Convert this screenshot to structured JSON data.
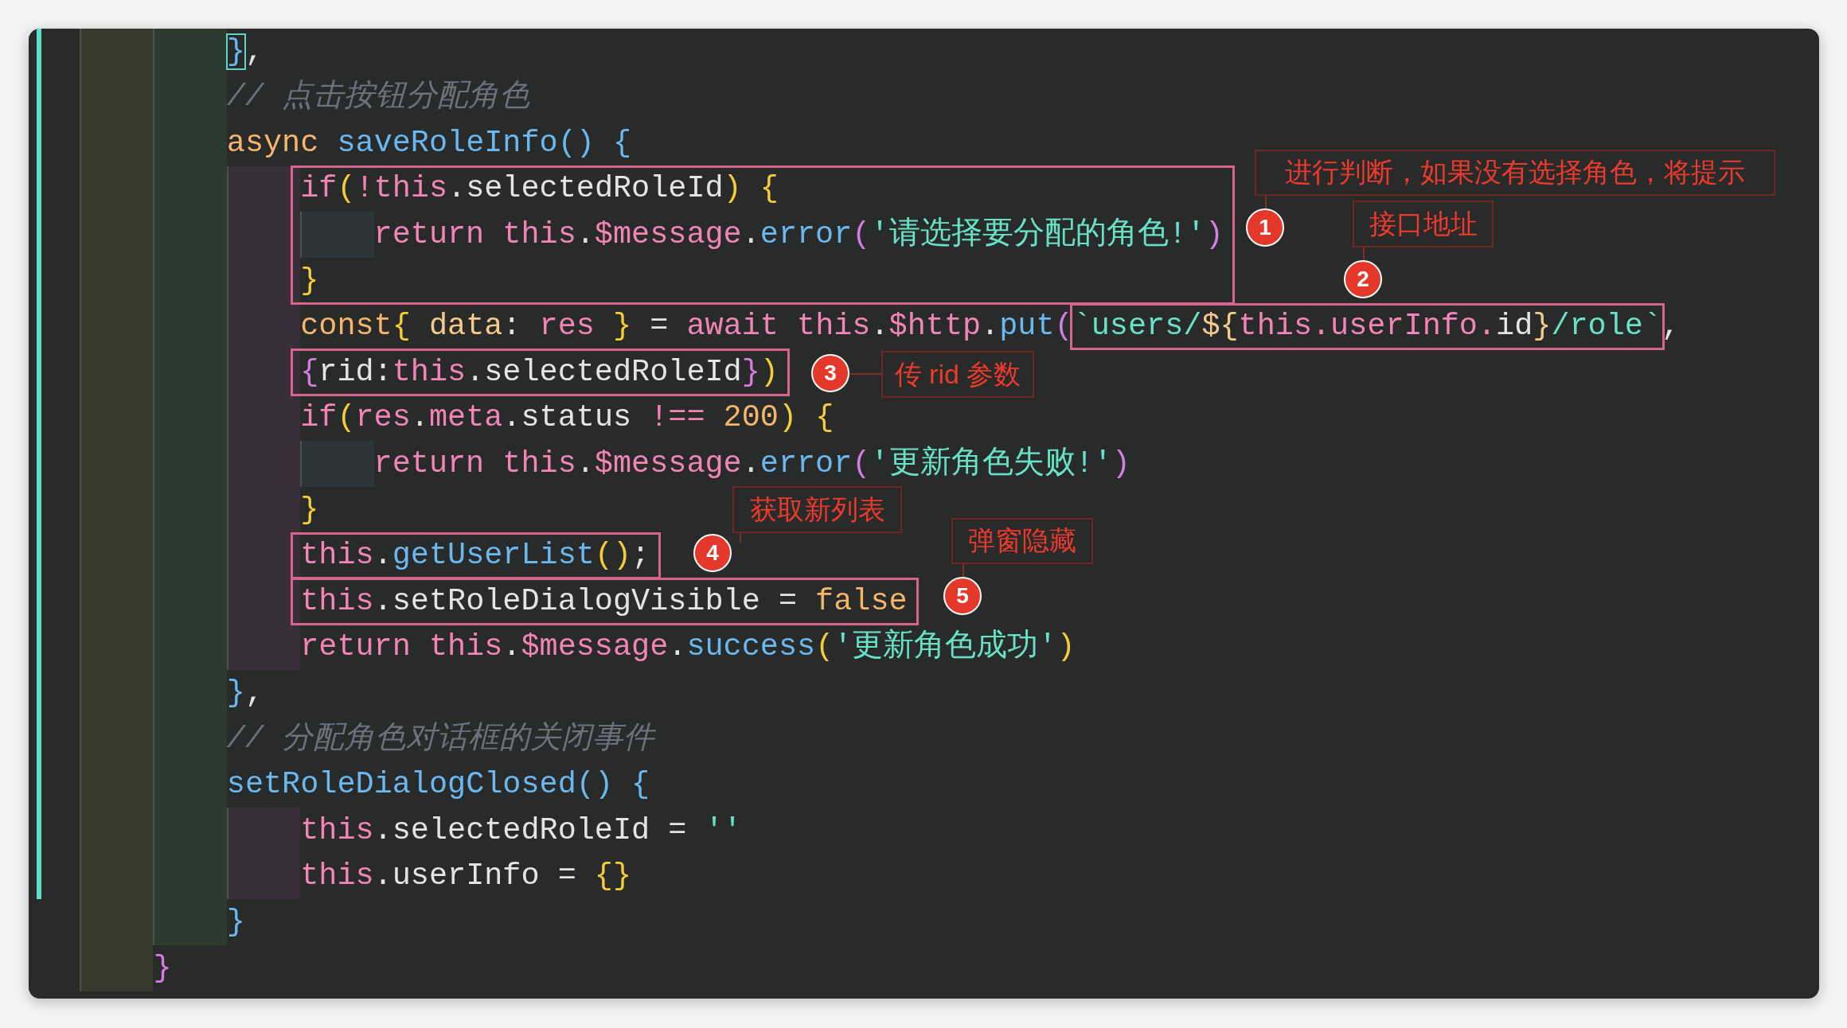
{
  "editor": {
    "blocks": [
      {
        "kind": "block",
        "children": [
          {
            "kind": "line",
            "modified": true,
            "tokens": [
              {
                "t": "}",
                "color": "#6ab8ef",
                "bracket_match": true
              },
              {
                "t": ",",
                "color": "#e4e4e4"
              }
            ]
          },
          {
            "kind": "comment",
            "modified": true,
            "tokens": [
              {
                "t": "// 点击按钮分配角色",
                "color": "#6d717c"
              }
            ]
          },
          {
            "kind": "block",
            "open": {
              "modified": true,
              "tokens": [
                {
                  "t": "async ",
                  "color": "#f6b56c"
                },
                {
                  "t": "saveRoleInfo",
                  "color": "#6ab8ef"
                },
                {
                  "t": "() {",
                  "color": "#6ab8ef"
                }
              ]
            },
            "children": [
              {
                "kind": "block",
                "boxed": true,
                "open": {
                  "modified": true,
                  "tokens": [
                    {
                      "t": "if",
                      "color": "#f185b5"
                    },
                    {
                      "t": "(",
                      "color": "#f5cd39"
                    },
                    {
                      "t": "!this",
                      "color": "#f185b5"
                    },
                    {
                      "t": ".selectedRoleId",
                      "color": "#e4e4e4"
                    },
                    {
                      "t": ") {",
                      "color": "#f5cd39"
                    }
                  ]
                },
                "children": [
                  {
                    "kind": "line",
                    "modified": true,
                    "tokens": [
                      {
                        "t": "return this",
                        "color": "#f185b5"
                      },
                      {
                        "t": ".",
                        "color": "#e4e4e4"
                      },
                      {
                        "t": "$message",
                        "color": "#f185b5"
                      },
                      {
                        "t": ".",
                        "color": "#e4e4e4"
                      },
                      {
                        "t": "error",
                        "color": "#6ab8ef"
                      },
                      {
                        "t": "(",
                        "color": "#d47fe0"
                      },
                      {
                        "t": "'请选择要分配的角色!'",
                        "color": "#68e2c6"
                      },
                      {
                        "t": ")",
                        "color": "#d47fe0"
                      }
                    ]
                  }
                ],
                "close": {
                  "modified": true,
                  "tokens": [
                    {
                      "t": "}",
                      "color": "#f5cd39"
                    }
                  ]
                }
              },
              {
                "kind": "line",
                "modified": true,
                "tokens": [
                  {
                    "t": "const",
                    "color": "#f6b56c"
                  },
                  {
                    "t": "{",
                    "color": "#f5cd39"
                  },
                  {
                    "t": " data",
                    "color": "#f6c98c"
                  },
                  {
                    "t": ": ",
                    "color": "#e4e4e4"
                  },
                  {
                    "t": "res",
                    "color": "#f185b5"
                  },
                  {
                    "t": " }",
                    "color": "#f5cd39"
                  },
                  {
                    "t": " = ",
                    "color": "#e4e4e4"
                  },
                  {
                    "t": "await this",
                    "color": "#f185b5"
                  },
                  {
                    "t": ".",
                    "color": "#e4e4e4"
                  },
                  {
                    "t": "$http",
                    "color": "#f185b5"
                  },
                  {
                    "t": ".",
                    "color": "#e4e4e4"
                  },
                  {
                    "t": "put",
                    "color": "#6ab8ef"
                  },
                  {
                    "t": "(",
                    "color": "#d47fe0"
                  },
                  {
                    "kind": "group",
                    "boxed": true,
                    "tokens": [
                      {
                        "t": "`users/",
                        "color": "#68e2c6"
                      },
                      {
                        "t": "${",
                        "color": "#f6c98c"
                      },
                      {
                        "t": "this.userInfo.",
                        "color": "#f185b5"
                      },
                      {
                        "t": "id",
                        "color": "#e4e4e4"
                      },
                      {
                        "t": "}",
                        "color": "#f6c98c"
                      },
                      {
                        "t": "/role`",
                        "color": "#68e2c6"
                      }
                    ]
                  },
                  {
                    "t": ",",
                    "color": "#e4e4e4"
                  }
                ]
              },
              {
                "kind": "line",
                "modified": true,
                "boxed": true,
                "tokens": [
                  {
                    "t": "{",
                    "color": "#d47fe0"
                  },
                  {
                    "t": "rid:",
                    "color": "#e4e4e4"
                  },
                  {
                    "t": "this",
                    "color": "#f185b5"
                  },
                  {
                    "t": ".selectedRoleId",
                    "color": "#e4e4e4"
                  },
                  {
                    "t": "}",
                    "color": "#d47fe0"
                  },
                  {
                    "t": ")",
                    "color": "#f5cd39"
                  }
                ]
              },
              {
                "kind": "block",
                "open": {
                  "modified": true,
                  "tokens": [
                    {
                      "t": "if",
                      "color": "#f185b5"
                    },
                    {
                      "t": "(",
                      "color": "#f5cd39"
                    },
                    {
                      "t": "res",
                      "color": "#f185b5"
                    },
                    {
                      "t": ".",
                      "color": "#e4e4e4"
                    },
                    {
                      "t": "meta",
                      "color": "#f185b5"
                    },
                    {
                      "t": ".status ",
                      "color": "#e4e4e4"
                    },
                    {
                      "t": "!==",
                      "color": "#f185b5"
                    },
                    {
                      "t": " 200",
                      "color": "#f6b56c"
                    },
                    {
                      "t": ") {",
                      "color": "#f5cd39"
                    }
                  ]
                },
                "children": [
                  {
                    "kind": "line",
                    "modified": true,
                    "tokens": [
                      {
                        "t": "return this",
                        "color": "#f185b5"
                      },
                      {
                        "t": ".",
                        "color": "#e4e4e4"
                      },
                      {
                        "t": "$message",
                        "color": "#f185b5"
                      },
                      {
                        "t": ".",
                        "color": "#e4e4e4"
                      },
                      {
                        "t": "error",
                        "color": "#6ab8ef"
                      },
                      {
                        "t": "(",
                        "color": "#d47fe0"
                      },
                      {
                        "t": "'更新角色失败!'",
                        "color": "#68e2c6"
                      },
                      {
                        "t": ")",
                        "color": "#d47fe0"
                      }
                    ]
                  }
                ],
                "close": {
                  "modified": true,
                  "tokens": [
                    {
                      "t": "}",
                      "color": "#f5cd39"
                    }
                  ]
                }
              },
              {
                "kind": "line",
                "modified": true,
                "boxed": true,
                "tokens": [
                  {
                    "t": "this",
                    "color": "#f185b5"
                  },
                  {
                    "t": ".",
                    "color": "#e4e4e4"
                  },
                  {
                    "t": "getUserList",
                    "color": "#6ab8ef"
                  },
                  {
                    "t": "()",
                    "color": "#f5cd39"
                  },
                  {
                    "t": ";",
                    "color": "#e4e4e4"
                  }
                ]
              },
              {
                "kind": "line",
                "modified": true,
                "boxed": true,
                "tokens": [
                  {
                    "t": "this",
                    "color": "#f185b5"
                  },
                  {
                    "t": ".setRoleDialogVisible = ",
                    "color": "#e4e4e4"
                  },
                  {
                    "t": "false",
                    "color": "#f6b56c"
                  }
                ]
              },
              {
                "kind": "line",
                "modified": true,
                "tokens": [
                  {
                    "t": "return this",
                    "color": "#f185b5"
                  },
                  {
                    "t": ".",
                    "color": "#e4e4e4"
                  },
                  {
                    "t": "$message",
                    "color": "#f185b5"
                  },
                  {
                    "t": ".",
                    "color": "#e4e4e4"
                  },
                  {
                    "t": "success",
                    "color": "#6ab8ef"
                  },
                  {
                    "t": "(",
                    "color": "#f5cd39"
                  },
                  {
                    "t": "'更新角色成功'",
                    "color": "#68e2c6"
                  },
                  {
                    "t": ")",
                    "color": "#f5cd39"
                  }
                ]
              }
            ],
            "close": {
              "modified": true,
              "tokens": [
                {
                  "t": "}",
                  "color": "#6ab8ef"
                },
                {
                  "t": ",",
                  "color": "#e4e4e4"
                }
              ]
            }
          },
          {
            "kind": "comment",
            "modified": true,
            "tokens": [
              {
                "t": "// 分配角色对话框的关闭事件",
                "color": "#6d717c"
              }
            ]
          },
          {
            "kind": "block",
            "open": {
              "modified": true,
              "tokens": [
                {
                  "t": "setRoleDialogClosed",
                  "color": "#6ab8ef"
                },
                {
                  "t": "() {",
                  "color": "#6ab8ef"
                }
              ]
            },
            "children": [
              {
                "kind": "line",
                "modified": true,
                "tokens": [
                  {
                    "t": "this",
                    "color": "#f185b5"
                  },
                  {
                    "t": ".selectedRoleId = ",
                    "color": "#e4e4e4"
                  },
                  {
                    "t": "''",
                    "color": "#68e2c6"
                  }
                ]
              },
              {
                "kind": "line",
                "modified": true,
                "tokens": [
                  {
                    "t": "this",
                    "color": "#f185b5"
                  },
                  {
                    "t": ".userInfo = ",
                    "color": "#e4e4e4"
                  },
                  {
                    "t": "{}",
                    "color": "#f5cd39"
                  }
                ]
              }
            ],
            "close": {
              "modified": false,
              "tokens": [
                {
                  "t": "}",
                  "color": "#6ab8ef"
                }
              ]
            }
          }
        ],
        "close": {
          "modified": false,
          "tokens": [
            {
              "t": "}",
              "color": "#d47fe0"
            }
          ]
        }
      }
    ]
  },
  "callouts": [
    {
      "number": "1",
      "label": "进行判断，如果没有选择角色，将提示"
    },
    {
      "number": "2",
      "label": "接口地址"
    },
    {
      "number": "3",
      "label": "传 rid 参数"
    },
    {
      "number": "4",
      "label": "获取新列表"
    },
    {
      "number": "5",
      "label": "弹窗隐藏"
    }
  ]
}
